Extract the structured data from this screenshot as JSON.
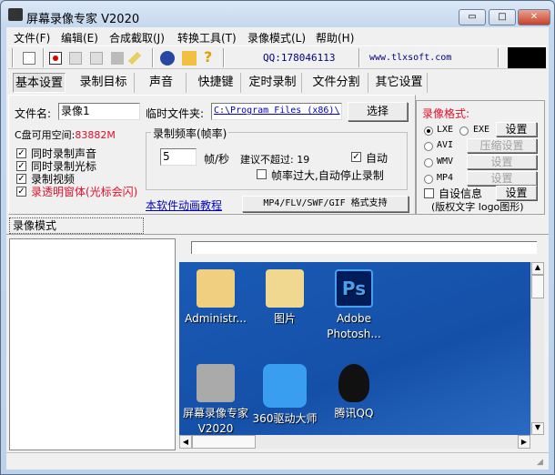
{
  "window": {
    "title": "屏幕录像专家 V2020",
    "min": "▭",
    "max": "□",
    "close": "✕"
  },
  "menu": [
    "文件(F)",
    "编辑(E)",
    "合成截取(J)",
    "转换工具(T)",
    "录像模式(L)",
    "帮助(H)"
  ],
  "toolbar": {
    "qq": "QQ:178046113",
    "website": "www.tlxsoft.com"
  },
  "tabs": [
    "基本设置",
    "录制目标",
    "声音",
    "快捷键",
    "定时录制",
    "文件分割",
    "其它设置"
  ],
  "basic": {
    "filename_label": "文件名:",
    "filename_value": "录像1",
    "tempdir_label": "临时文件夹:",
    "tempdir_value": "C:\\Program Files (x86)\\",
    "choose_button": "选择",
    "disk_label": "C盘可用空间:",
    "disk_value": "83882M",
    "checks": [
      {
        "label": "同时录制声音",
        "checked": true
      },
      {
        "label": "同时录制光标",
        "checked": true
      },
      {
        "label": "录制视频",
        "checked": true
      },
      {
        "label": "录透明窗体(光标会闪)",
        "checked": true
      }
    ],
    "fps_group": "录制频率(帧率)",
    "fps_value": "5",
    "fps_unit": "帧/秒",
    "fps_suggest": "建议不超过: 19",
    "auto_label": "自动",
    "auto_checked": true,
    "autostop_label": "帧率过大,自动停止录制",
    "autostop_checked": false,
    "tutorial_link": "本软件动画教程",
    "format_support_button": "MP4/FLV/SWF/GIF  格式支持"
  },
  "format": {
    "title": "录像格式:",
    "lxe": "LXE",
    "exe": "EXE",
    "avi": "AVI",
    "wmv": "WMV",
    "mp4": "MP4",
    "selected": "LXE",
    "settings": "设置",
    "compress_settings": "压缩设置",
    "custom_info": "自设信息",
    "custom_info_checked": false,
    "note": "(版权文字 logo图形)"
  },
  "mode_tab": "录像模式",
  "desktop": [
    {
      "label": "Administr..."
    },
    {
      "label": "图片"
    },
    {
      "label": "Adobe Photosh..."
    },
    {
      "label": "屏幕录像专家 V2020"
    },
    {
      "label": "360驱动大师"
    },
    {
      "label": "腾讯QQ"
    }
  ],
  "colors": {
    "accent_red": "#e0102a",
    "link": "#0000c0",
    "desktop": "#1a5ab5"
  }
}
